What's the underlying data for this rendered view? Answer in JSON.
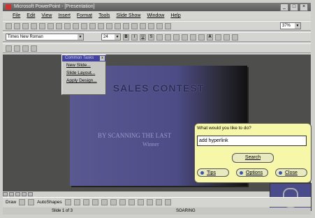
{
  "window": {
    "title": "Microsoft PowerPoint - [Presentation]",
    "min": "_",
    "max": "□",
    "close": "×"
  },
  "menu": [
    "File",
    "Edit",
    "View",
    "Insert",
    "Format",
    "Tools",
    "Slide Show",
    "Window",
    "Help"
  ],
  "format_toolbar": {
    "font": "Times New Roman",
    "size": "24",
    "bold": "B",
    "italic": "I",
    "underline": "U",
    "shadow": "S",
    "grow_font": "A"
  },
  "standard_toolbar": {
    "zoom": "37%"
  },
  "popup_menu": {
    "title": "Common Tasks",
    "close": "x",
    "items": [
      "New Slide...",
      "Slide Layout...",
      "Apply Design..."
    ]
  },
  "slide": {
    "title": "SALES CONTEST",
    "subtitle": "BY SCANNING THE LAST",
    "subtitle2": "Winner"
  },
  "assistant": {
    "question": "What would you like to do?",
    "input_value": "add hyperlink",
    "search_label": "Search",
    "tips_label": "Tips",
    "options_label": "Options",
    "close_label": "Close"
  },
  "drawing_toolbar": {
    "draw_label": "Draw",
    "autoshapes_label": "AutoShapes"
  },
  "statusbar": {
    "slide": "Slide 1 of 3",
    "design": "SOARING"
  },
  "colors": {
    "workspace": "#4e4f4d",
    "slide": "#5a5891",
    "balloon": "#f6f7a8",
    "popup_title": "#4343a0"
  }
}
